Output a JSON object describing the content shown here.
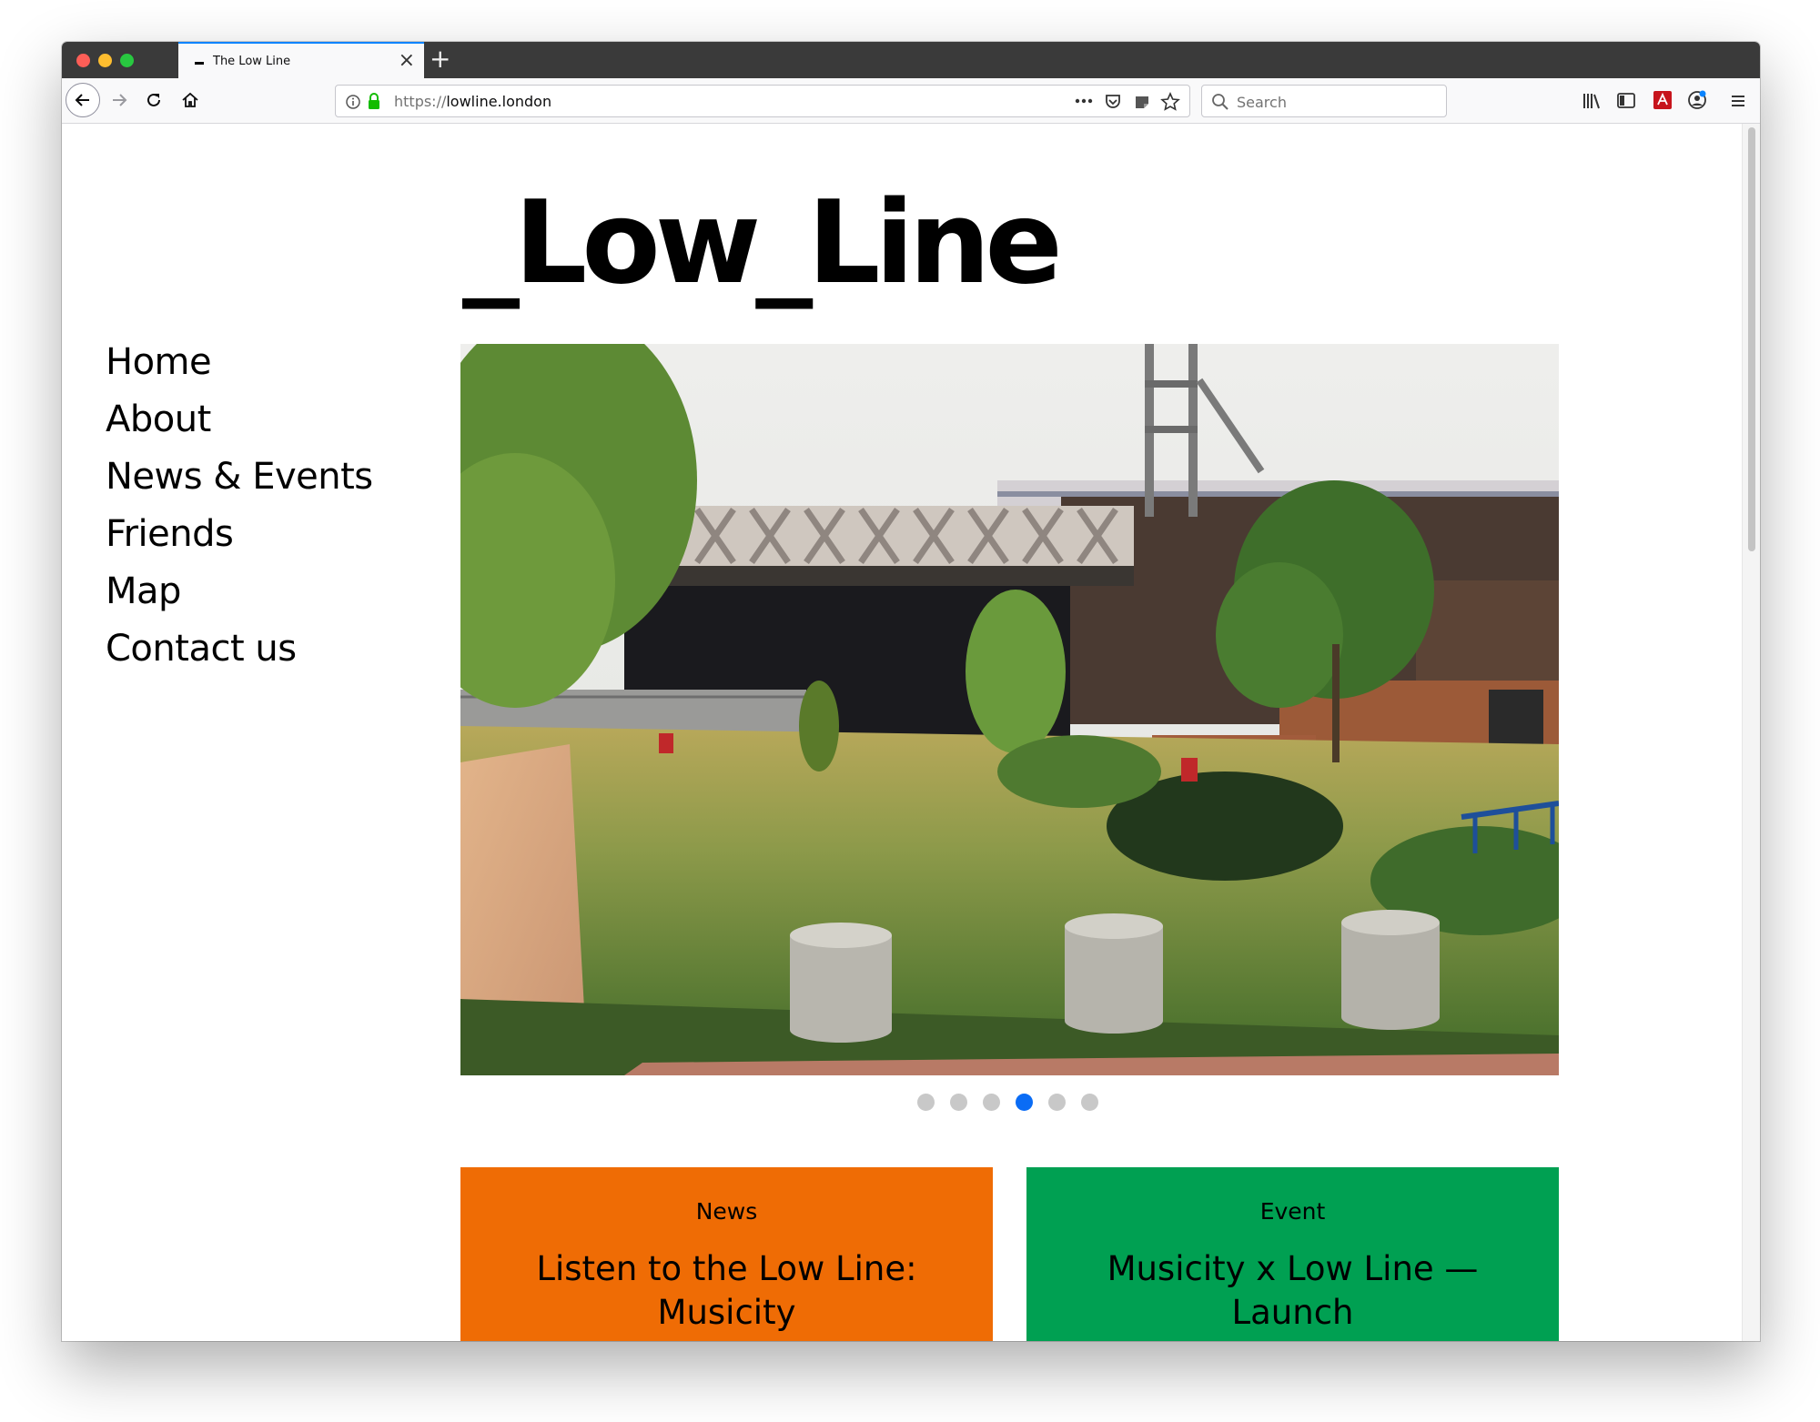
{
  "browser": {
    "tab_title": "The Low Line",
    "url_protocol": "https://",
    "url_host": "lowline.london",
    "search_placeholder": "Search"
  },
  "site": {
    "logo": "_Low_Line",
    "nav": [
      "Home",
      "About",
      "News & Events",
      "Friends",
      "Map",
      "Contact us"
    ]
  },
  "carousel": {
    "slide_count": 6,
    "active_index": 3,
    "active_color": "#0a6cf5",
    "inactive_color": "#c8c8c8"
  },
  "cards": [
    {
      "label": "News",
      "title": "Listen to the Low Line: Musicity",
      "color": "#ef6c05"
    },
    {
      "label": "Event",
      "title": "Musicity x Low Line — Launch",
      "color": "#00a052"
    }
  ]
}
